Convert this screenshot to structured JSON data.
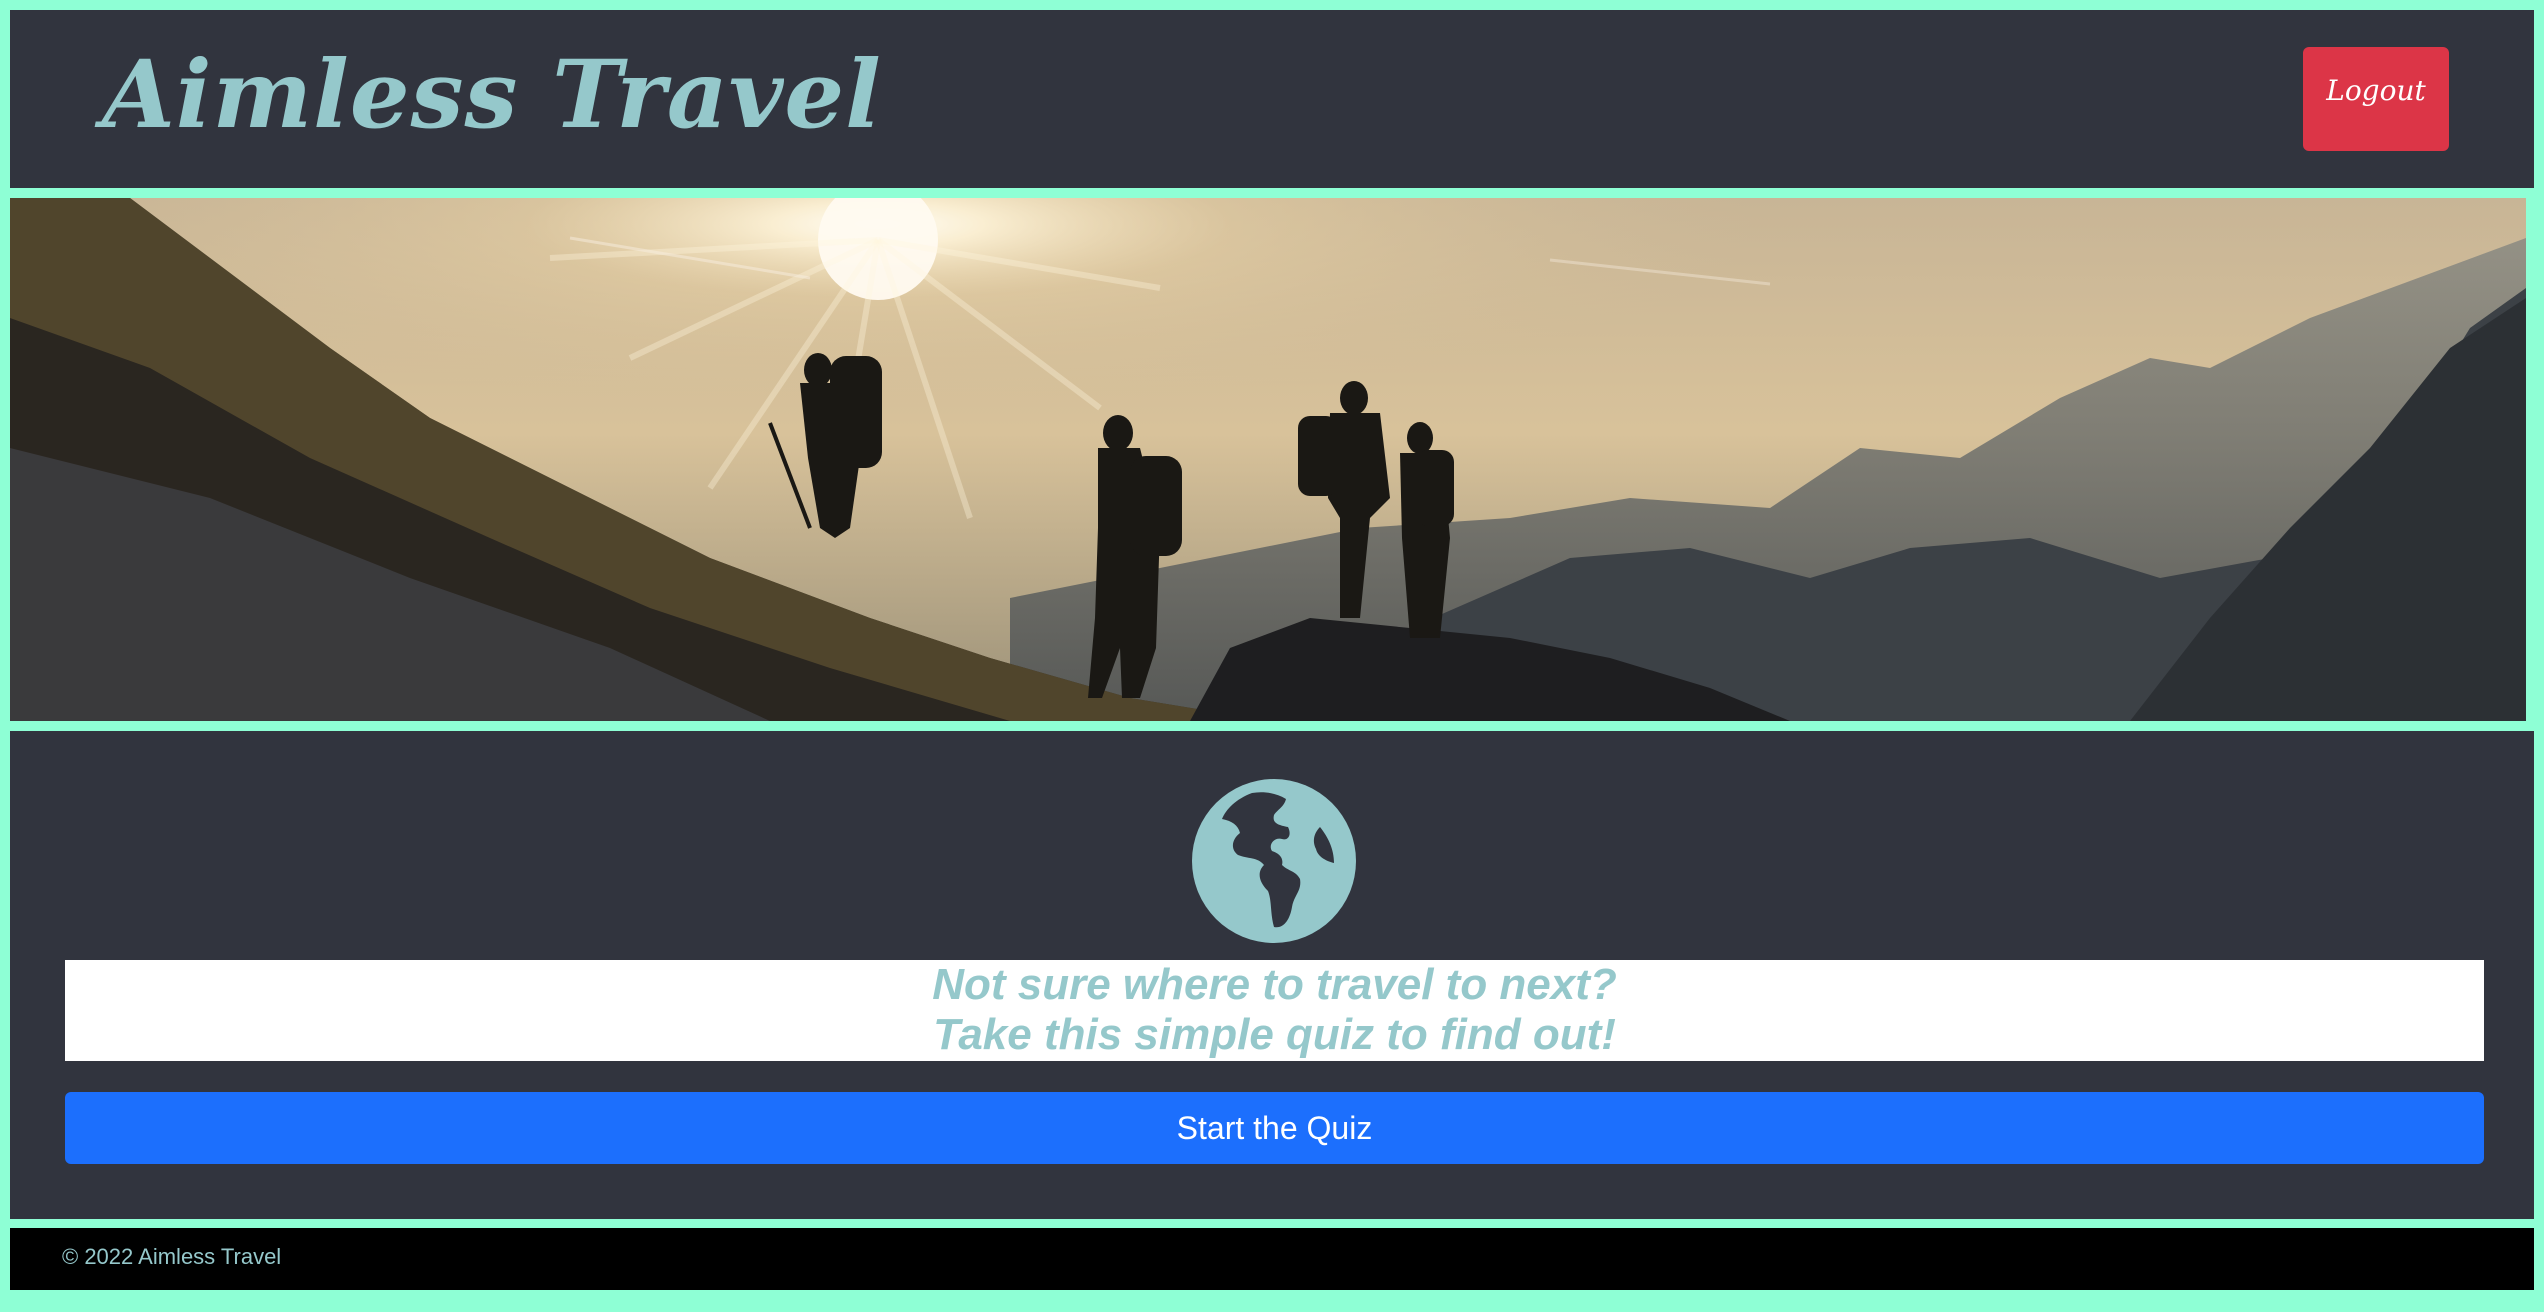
{
  "header": {
    "brand": "Aimless Travel",
    "logout_label": "Logout"
  },
  "hero": {
    "image": "mountain-hikers-sunset-photo"
  },
  "main": {
    "icon": "globe-americas-icon",
    "tagline_line1": "Not sure where to travel to next?",
    "tagline_line2": "Take this simple quiz to find out!",
    "start_label": "Start the Quiz"
  },
  "footer": {
    "copyright": "© 2022 Aimless Travel"
  },
  "colors": {
    "page_border": "#8effd5",
    "panel_bg": "#31343e",
    "accent_text": "#95c8cb",
    "logout_bg": "#dc3547",
    "primary_button": "#1c6ffd",
    "footer_bg": "#000000"
  }
}
